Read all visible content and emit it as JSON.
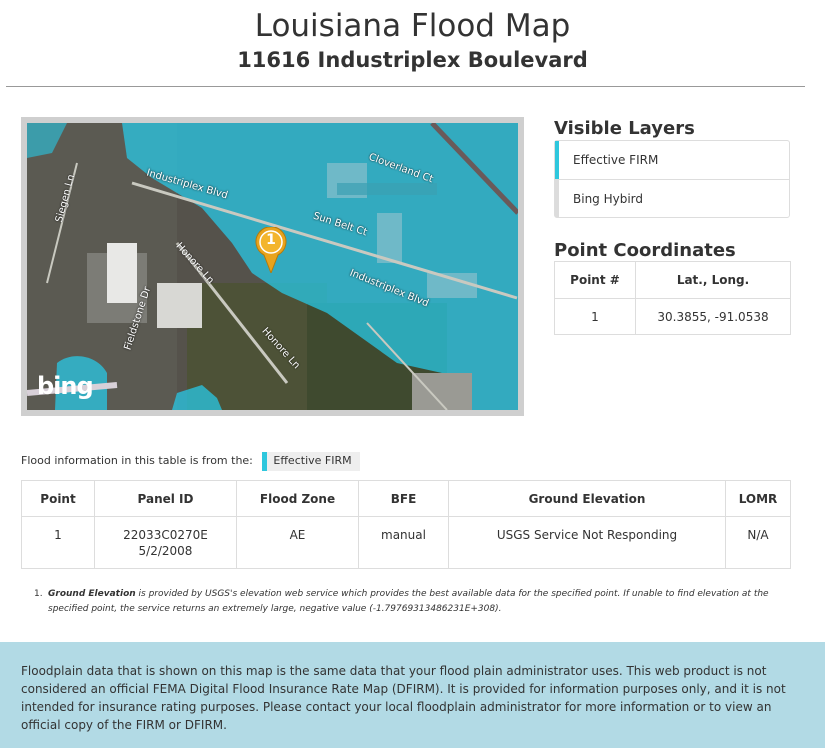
{
  "header": {
    "title": "Louisiana Flood Map",
    "address": "11616 Industriplex Boulevard"
  },
  "map": {
    "logo": "bing",
    "marker_label": "1",
    "street_labels": [
      "Industriplex Blvd",
      "Sun Belt Ct",
      "Cloverland Ct",
      "Honore Ln",
      "Fieldstone Dr",
      "Siegen Ln",
      "Industriplex Blvd",
      "Honore Ln",
      "Industriplex Blvd"
    ]
  },
  "visible_layers": {
    "title": "Visible Layers",
    "items": [
      {
        "label": "Effective FIRM",
        "active": true
      },
      {
        "label": "Bing Hybird",
        "active": false
      }
    ]
  },
  "point_coordinates": {
    "title": "Point Coordinates",
    "headers": [
      "Point #",
      "Lat., Long."
    ],
    "rows": [
      [
        "1",
        "30.3855, -91.0538"
      ]
    ]
  },
  "flood_info": {
    "prefix": "Flood information in this table is from the:",
    "source": "Effective FIRM"
  },
  "flood_table": {
    "headers": [
      "Point",
      "Panel ID",
      "Flood Zone",
      "BFE",
      "Ground Elevation",
      "LOMR"
    ],
    "rows": [
      {
        "point": "1",
        "panel_id": "22033C0270E",
        "panel_date": "5/2/2008",
        "zone": "AE",
        "bfe": "manual",
        "elevation": "USGS Service Not Responding",
        "lomr": "N/A"
      }
    ]
  },
  "note": {
    "number": "1.",
    "bold": "Ground Elevation",
    "text": " is provided by USGS's elevation web service which provides the best available data for the specified point. If unable to find elevation at the specified point, the service returns an extremely large, negative value (-1.79769313486231E+308)."
  },
  "footer": {
    "text": "Floodplain data that is shown on this map is the same data that your flood plain administrator uses. This web product is not considered an official FEMA Digital Flood Insurance Rate Map (DFIRM). It is provided for information purposes only, and it is not intended for insurance rating purposes. Please contact your local floodplain administrator for more information or to view an official copy of the FIRM or DFIRM."
  },
  "colors": {
    "accent": "#2ec7dd",
    "flood_overlay": "#28c8e6",
    "footer_bg": "#b2dae5",
    "marker": "#e8a31c"
  }
}
